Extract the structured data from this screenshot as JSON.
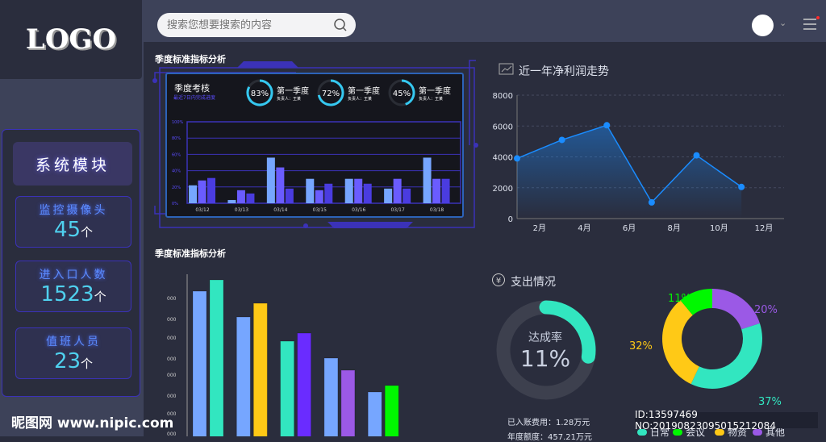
{
  "logo": "LOGO",
  "search": {
    "placeholder": "搜索您想要搜索的内容"
  },
  "sidebar": {
    "module_title": "系统模块",
    "stats": [
      {
        "label": "监控摄像头",
        "value": "45",
        "unit": "个"
      },
      {
        "label": "进入口人数",
        "value": "1523",
        "unit": "个"
      },
      {
        "label": "值班人员",
        "value": "23",
        "unit": "个"
      }
    ]
  },
  "watermark": "昵图网 www.nipic.com",
  "id_text": "ID:13597469 NO:20190823095015212084",
  "colors": {
    "accent": "#3b32b8",
    "teal": "#32e6c0",
    "yellow": "#ffc916",
    "green": "#00f800",
    "purple": "#9b59e6",
    "blue": "#1a8cff"
  },
  "chart_data": [
    {
      "type": "bar",
      "title": "季度标准指标分析",
      "panel_title": "季度考核",
      "panel_subtitle": "最近7日内完成进度",
      "gauges": [
        {
          "value": "83%",
          "pct": 83,
          "label": "第一季度",
          "owner": "负责人：王某"
        },
        {
          "value": "72%",
          "pct": 72,
          "label": "第一季度",
          "owner": "负责人：王某"
        },
        {
          "value": "45%",
          "pct": 45,
          "label": "第一季度",
          "owner": "负责人：王某"
        }
      ],
      "categories": [
        "03/12",
        "03/13",
        "03/14",
        "03/15",
        "03/16",
        "03/17",
        "03/18"
      ],
      "yticks": [
        "0%",
        "20%",
        "40%",
        "60%",
        "80%",
        "100%"
      ],
      "ylim": [
        0,
        100
      ],
      "series": [
        {
          "values": [
            22,
            4,
            56,
            30,
            30,
            18,
            56
          ],
          "color": "#76a6ff"
        },
        {
          "values": [
            28,
            16,
            44,
            16,
            30,
            30,
            30
          ],
          "color": "#6a5cff"
        },
        {
          "values": [
            31,
            12,
            18,
            24,
            24,
            18,
            30
          ],
          "color": "#4a3ce0"
        }
      ]
    },
    {
      "type": "line",
      "title": "近一年净利润走势",
      "x": [
        1,
        3,
        5,
        7,
        9,
        11
      ],
      "values": [
        3900,
        5100,
        6050,
        1050,
        4100,
        2050
      ],
      "xticks": [
        "2月",
        "4月",
        "6月",
        "8月",
        "10月",
        "12月"
      ],
      "xtick_values": [
        2,
        4,
        6,
        8,
        10,
        12
      ],
      "yticks": [
        "0",
        "2000",
        "4000",
        "6000",
        "8000"
      ],
      "ylim": [
        0,
        8000
      ]
    },
    {
      "type": "bar",
      "title": "季度标准指标分析",
      "ytick_label": "000",
      "ytick_count": 8,
      "groups": [
        [
          {
            "v": 199,
            "c": "#76a6ff"
          },
          {
            "v": 213,
            "c": "#32e6c0"
          }
        ],
        [
          {
            "v": 167,
            "c": "#76a6ff"
          },
          {
            "v": 184,
            "c": "#ffc916"
          }
        ],
        [
          {
            "v": 137,
            "c": "#32e6c0"
          },
          {
            "v": 147,
            "c": "#6a2cff"
          }
        ],
        [
          {
            "v": 116,
            "c": "#76a6ff"
          },
          {
            "v": 101,
            "c": "#9b59e6"
          }
        ],
        [
          {
            "v": 74,
            "c": "#76a6ff"
          },
          {
            "v": 82,
            "c": "#00f800"
          }
        ]
      ]
    },
    {
      "type": "pie",
      "title": "支出情况",
      "gauge": {
        "label": "达成率",
        "value": "11%",
        "pct": 11
      },
      "lines": [
        "已入账费用：1.28万元",
        "年度额度：457.21万元"
      ],
      "slices": [
        {
          "name": "其他",
          "value": 20,
          "label": "20%",
          "color": "#9b59e6"
        },
        {
          "name": "日常",
          "value": 37,
          "label": "37%",
          "color": "#32e6c0"
        },
        {
          "name": "物资",
          "value": 32,
          "label": "32%",
          "color": "#ffc916"
        },
        {
          "name": "会议",
          "value": 11,
          "label": "11%",
          "color": "#00f800"
        }
      ],
      "legend": [
        "日常",
        "会议",
        "物资",
        "其他"
      ]
    }
  ]
}
